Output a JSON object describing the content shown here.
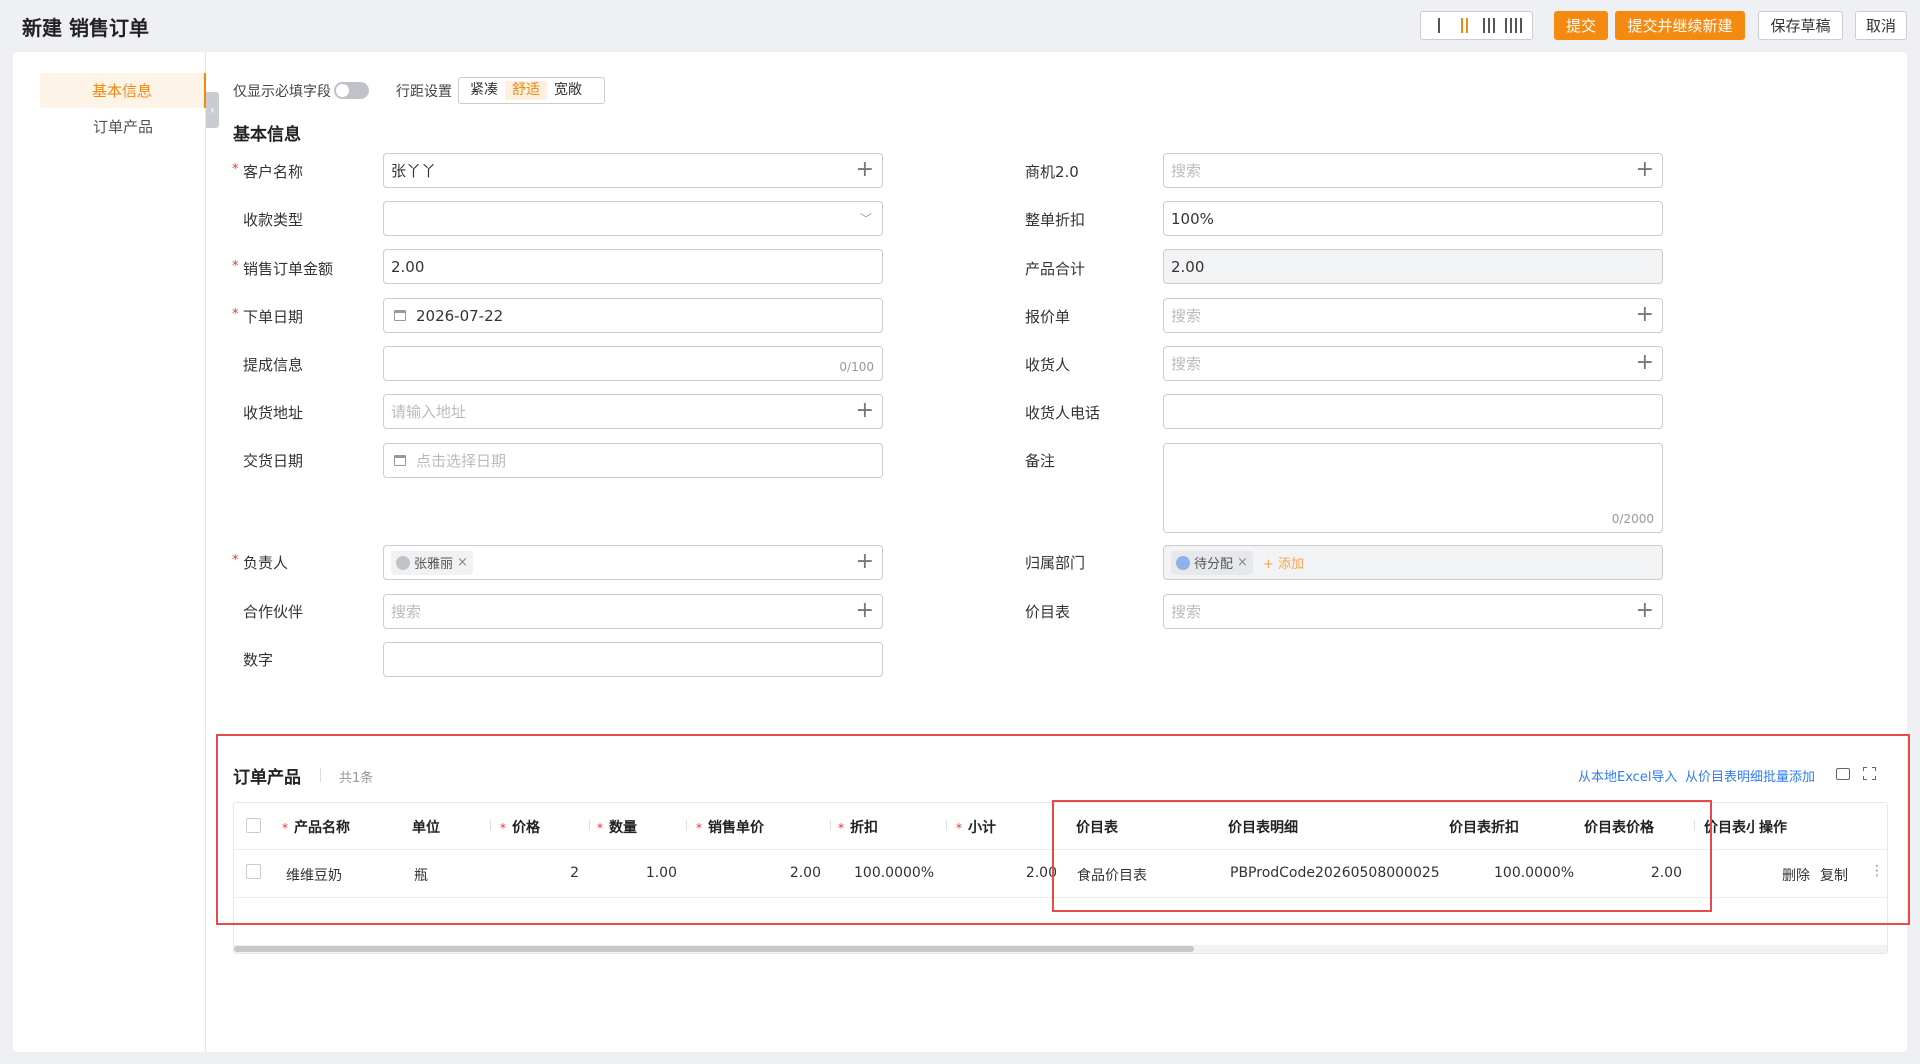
{
  "header": {
    "title": "新建 销售订单",
    "buttons": {
      "submit": "提交",
      "submit_and_new": "提交并继续新建",
      "save_draft": "保存草稿",
      "cancel": "取消"
    }
  },
  "sidebar": {
    "items": [
      {
        "label": "基本信息",
        "active": true
      },
      {
        "label": "订单产品",
        "active": false
      }
    ]
  },
  "options": {
    "required_only_label": "仅显示必填字段",
    "density_label": "行距设置",
    "density_options": [
      "紧凑",
      "舒适",
      "宽敞"
    ],
    "density_selected": "舒适"
  },
  "basic_info": {
    "title": "基本信息",
    "left": {
      "customer": {
        "label": "客户名称",
        "value": "张丫丫"
      },
      "payment_type": {
        "label": "收款类型",
        "value": ""
      },
      "amount": {
        "label": "销售订单金额",
        "value": "2.00"
      },
      "order_date": {
        "label": "下单日期",
        "value": "2026-07-22"
      },
      "commission": {
        "label": "提成信息",
        "counter": "0/100"
      },
      "address": {
        "label": "收货地址",
        "placeholder": "请输入地址"
      },
      "delivery_date": {
        "label": "交货日期",
        "placeholder": "点击选择日期"
      },
      "owner": {
        "label": "负责人",
        "tag": "张雅丽"
      },
      "partner": {
        "label": "合作伙伴",
        "placeholder": "搜索"
      },
      "number": {
        "label": "数字",
        "value": ""
      }
    },
    "right": {
      "opportunity": {
        "label": "商机2.0",
        "placeholder": "搜索"
      },
      "discount": {
        "label": "整单折扣",
        "value": "100%"
      },
      "product_total": {
        "label": "产品合计",
        "value": "2.00"
      },
      "quote": {
        "label": "报价单",
        "placeholder": "搜索"
      },
      "consignee": {
        "label": "收货人",
        "placeholder": "搜索"
      },
      "consignee_phone": {
        "label": "收货人电话",
        "value": ""
      },
      "remark": {
        "label": "备注",
        "counter": "0/2000"
      },
      "department": {
        "label": "归属部门",
        "tag": "待分配",
        "add": "+ 添加"
      },
      "price_list": {
        "label": "价目表",
        "placeholder": "搜索"
      }
    }
  },
  "order_products": {
    "title": "订单产品",
    "count": "共1条",
    "import_excel": "从本地Excel导入",
    "batch_add": "从价目表明细批量添加",
    "columns": [
      "产品名称",
      "单位",
      "价格",
      "数量",
      "销售单价",
      "折扣",
      "小计",
      "价目表",
      "价目表明细",
      "价目表折扣",
      "价目表价格",
      "价目表小",
      "操作"
    ],
    "rows": [
      {
        "product": "维维豆奶",
        "unit": "瓶",
        "price": "2",
        "quantity": "1.00",
        "sale_price": "2.00",
        "discount": "100.0000%",
        "subtotal": "2.00",
        "price_list": "食品价目表",
        "price_list_detail": "PBProdCode20260508000025",
        "price_list_discount": "100.0000%",
        "price_list_price": "2.00",
        "delete": "删除",
        "copy": "复制"
      }
    ]
  }
}
